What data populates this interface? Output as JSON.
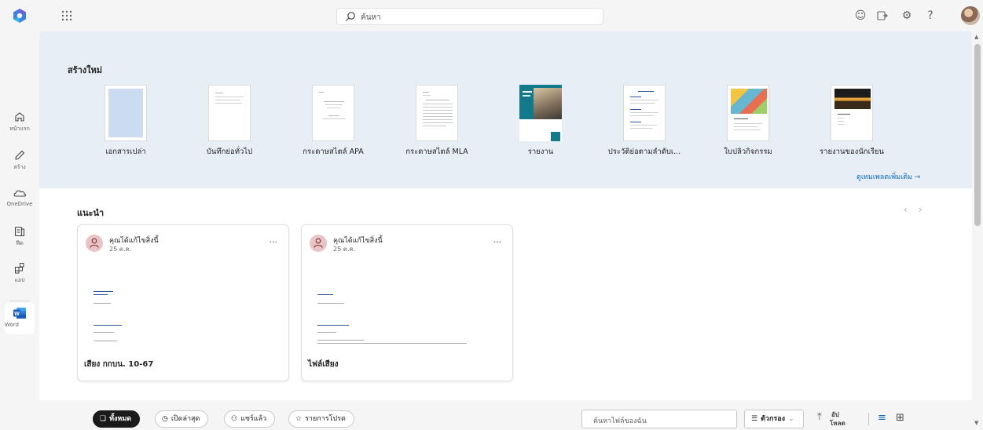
{
  "topbar": {
    "search_placeholder": "ค้นหา"
  },
  "rail": {
    "items": [
      {
        "label": "หน้าแรก",
        "icon": "home-icon"
      },
      {
        "label": "สร้าง",
        "icon": "create-icon"
      },
      {
        "label": "OneDrive",
        "icon": "onedrive-icon"
      },
      {
        "label": "ฟีด",
        "icon": "feed-icon"
      },
      {
        "label": "แอป",
        "icon": "apps-icon"
      },
      {
        "label": "Word",
        "icon": "word-icon"
      }
    ]
  },
  "new_section": {
    "title": "สร้างใหม่",
    "templates": [
      {
        "label": "เอกสารเปล่า"
      },
      {
        "label": "บันทึกย่อทั่วไป"
      },
      {
        "label": "กระดาษสไตล์ APA"
      },
      {
        "label": "กระดาษสไตล์ MLA"
      },
      {
        "label": "รายงาน"
      },
      {
        "label": "ประวัติย่อตามลำดับเ..."
      },
      {
        "label": "ใบปลิวกิจกรรม"
      },
      {
        "label": "รายงานของนักเรียน"
      }
    ],
    "more_templates": "ดูเทมเพลตเพิ่มเติม →"
  },
  "recommended": {
    "title": "แนะนำ",
    "cards": [
      {
        "activity": "คุณได้แก้ไขสิ่งนี้",
        "date": "25 ต.ค.",
        "more": "...",
        "name": "เสียง กกบน. 10-67"
      },
      {
        "activity": "คุณได้แก้ไขสิ่งนี้",
        "date": "25 ต.ค.",
        "more": "...",
        "name": "ไฟล์เสียง"
      }
    ]
  },
  "filters": {
    "all": "ทั้งหมด",
    "recent": "เปิดล่าสุด",
    "shared": "แชร์แล้ว",
    "favorites": "รายการโปรด",
    "file_search_placeholder": "ค้นหาไฟล์ของฉัน",
    "filter_label": "ตัวกรอง",
    "upload_line1": "อัป",
    "upload_line2": "โหลด"
  },
  "colors": {
    "accent": "#0f6cbd",
    "word": "#185abd",
    "create_bg": "#e8eef6"
  }
}
